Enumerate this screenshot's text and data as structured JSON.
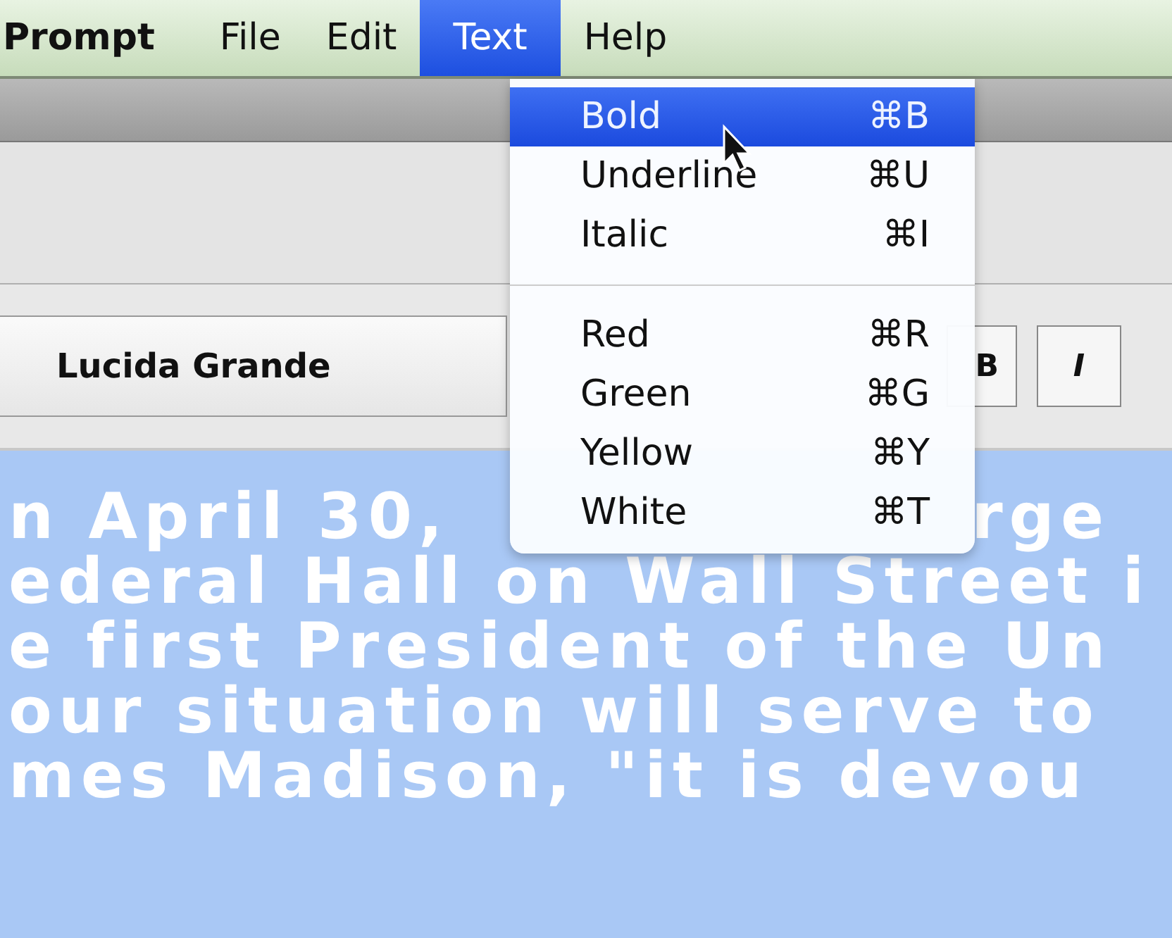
{
  "menubar": {
    "app_name": "Prompt",
    "menus": [
      {
        "label": "File",
        "selected": false
      },
      {
        "label": "Edit",
        "selected": false
      },
      {
        "label": "Text",
        "selected": true
      },
      {
        "label": "Help",
        "selected": false
      }
    ]
  },
  "format_bar": {
    "font_popup": "Lucida Grande",
    "style_buttons": [
      "B",
      "I"
    ]
  },
  "text_view": {
    "lines": [
      [
        "n April 30,",
        "rge"
      ],
      [
        "ederal Hall on Wall Street i"
      ],
      [
        "e first President of the Un"
      ],
      [
        "our situation will serve to"
      ],
      [
        "mes Madison, \"it is devou"
      ]
    ]
  },
  "text_menu": {
    "items": [
      {
        "kind": "item",
        "label": "Bold",
        "shortcut": "⌘B",
        "selected": true
      },
      {
        "kind": "item",
        "label": "Underline",
        "shortcut": "⌘U",
        "selected": false
      },
      {
        "kind": "item",
        "label": "Italic",
        "shortcut": "⌘I",
        "selected": false
      },
      {
        "kind": "separator"
      },
      {
        "kind": "item",
        "label": "Red",
        "shortcut": "⌘R",
        "selected": false
      },
      {
        "kind": "item",
        "label": "Green",
        "shortcut": "⌘G",
        "selected": false
      },
      {
        "kind": "item",
        "label": "Yellow",
        "shortcut": "⌘Y",
        "selected": false
      },
      {
        "kind": "item",
        "label": "White",
        "shortcut": "⌘T",
        "selected": false
      }
    ]
  }
}
